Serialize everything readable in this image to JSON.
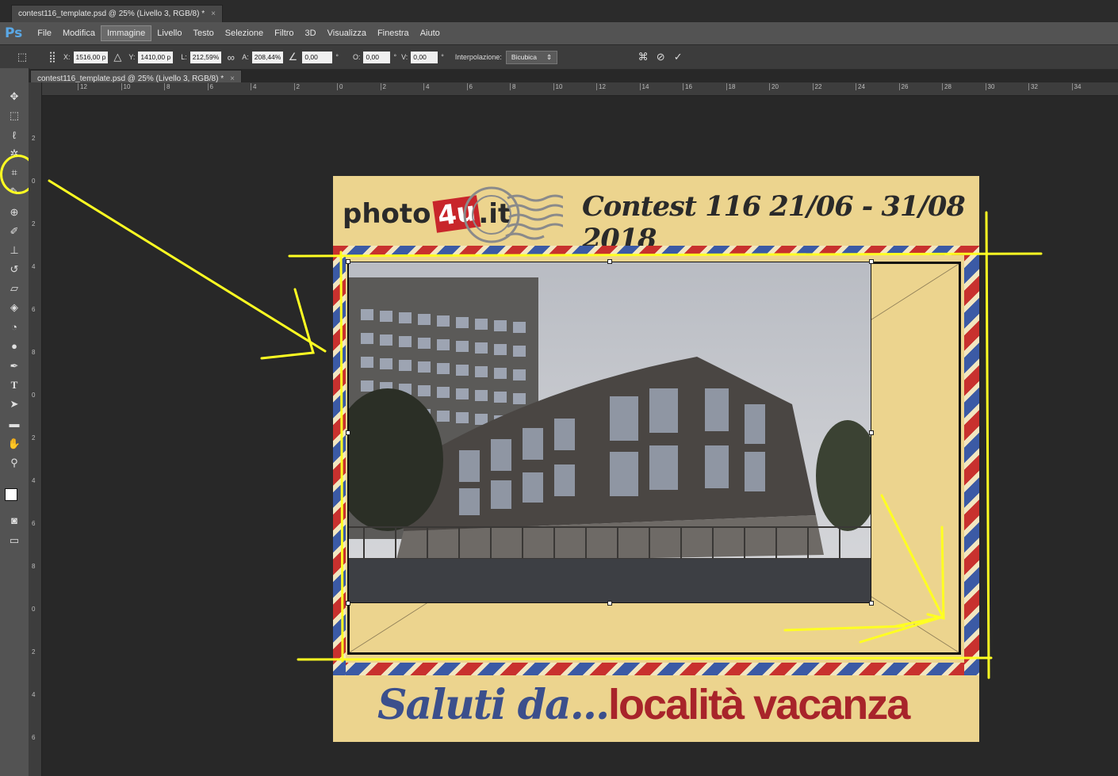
{
  "top_tab": {
    "title": "contest116_template.psd @ 25% (Livello 3, RGB/8) *",
    "close": "×"
  },
  "menubar": {
    "logo": "Ps",
    "items": [
      "File",
      "Modifica",
      "Immagine",
      "Livello",
      "Testo",
      "Selezione",
      "Filtro",
      "3D",
      "Visualizza",
      "Finestra",
      "Aiuto"
    ],
    "active": "Immagine"
  },
  "options": {
    "x_label": "X:",
    "x_value": "1516,00 p",
    "y_label": "Y:",
    "y_value": "1410,00 p",
    "w_label": "L:",
    "w_value": "212,59%",
    "h_label": "A:",
    "h_value": "208,44%",
    "rot_value": "0,00",
    "rot_unit": "°",
    "hskew_label": "O:",
    "hskew_value": "0,00",
    "hskew_unit": "°",
    "vskew_label": "V:",
    "vskew_value": "0,00",
    "vskew_unit": "°",
    "interp_label": "Interpolazione:",
    "interp_value": "Bicubica"
  },
  "doc_tab": {
    "title": "contest116_template.psd @ 25% (Livello 3, RGB/8) *",
    "close": "×"
  },
  "ruler_h": [
    "12",
    "10",
    "8",
    "6",
    "4",
    "2",
    "0",
    "2",
    "4",
    "6",
    "8",
    "10",
    "12",
    "14",
    "16",
    "18",
    "20",
    "22",
    "24",
    "26",
    "28",
    "30",
    "32",
    "34"
  ],
  "ruler_v": [
    "2",
    "0",
    "2",
    "4",
    "6",
    "8",
    "0",
    "2",
    "4",
    "6",
    "8",
    "0",
    "2",
    "4",
    "6"
  ],
  "postcard": {
    "logo_prefix": "photo",
    "logo_highlight": "4u",
    "logo_suffix": ".it",
    "contest_title": "Contest 116 21/06 - 31/08 2018",
    "greeting_prefix": "Saluti da...",
    "greeting_place": "località vacanza"
  },
  "colors": {
    "accent_yellow": "#ffff22",
    "brand_red": "#c8262b",
    "brand_blue": "#3b4f8c",
    "ps_blue": "#5aa8e6",
    "card_bg": "#ecd48e"
  }
}
